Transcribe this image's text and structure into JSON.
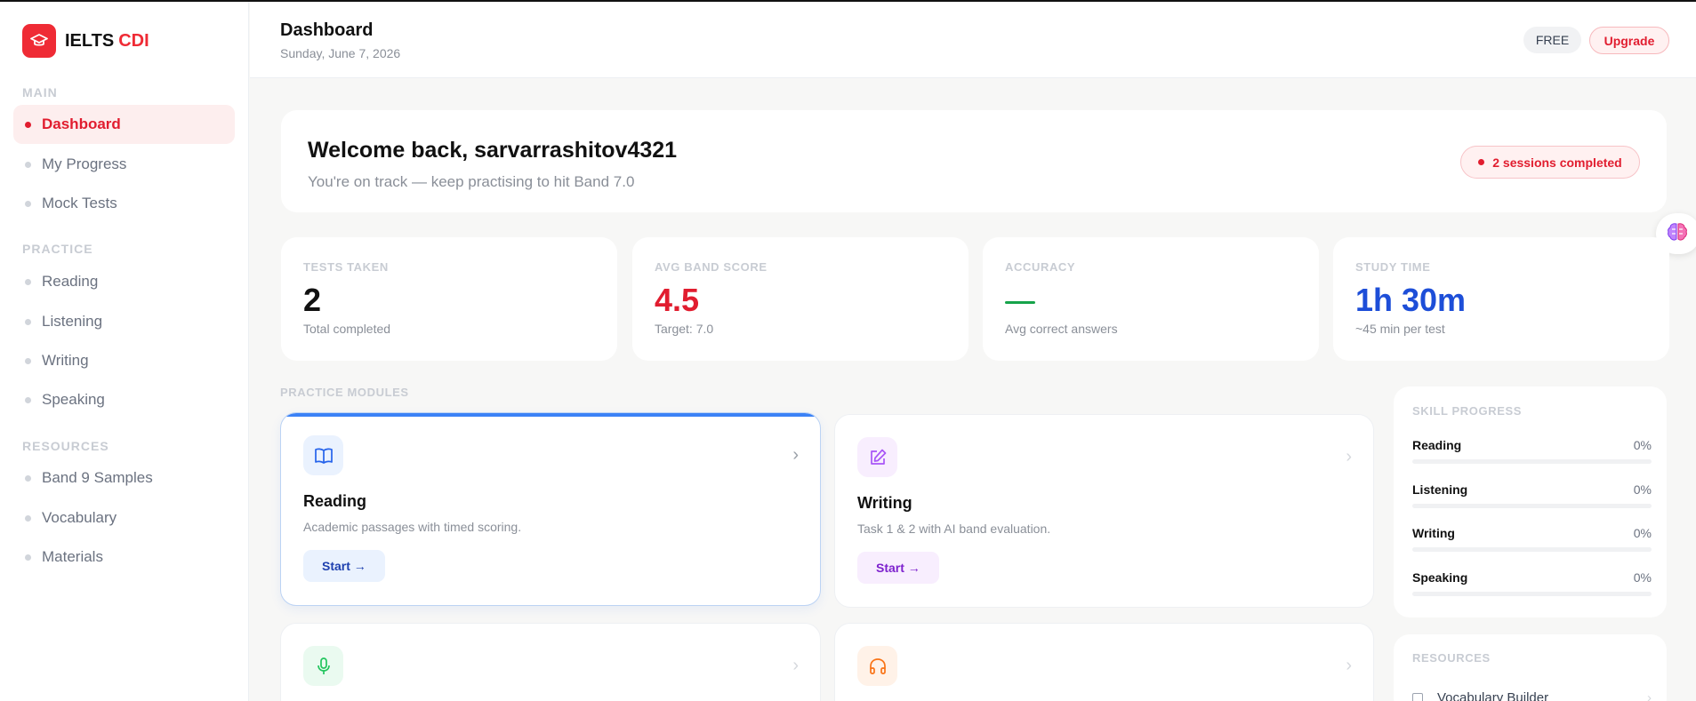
{
  "brand": {
    "name": "IELTS",
    "accent": "CDI",
    "icon": "graduation-cap-icon",
    "color": "#ef2b35"
  },
  "sidebar": {
    "sections": [
      {
        "title": "MAIN",
        "items": [
          {
            "label": "Dashboard",
            "active": true
          },
          {
            "label": "My Progress"
          },
          {
            "label": "Mock Tests"
          }
        ]
      },
      {
        "title": "PRACTICE",
        "items": [
          {
            "label": "Reading"
          },
          {
            "label": "Listening"
          },
          {
            "label": "Writing"
          },
          {
            "label": "Speaking"
          }
        ]
      },
      {
        "title": "RESOURCES",
        "items": [
          {
            "label": "Band 9 Samples"
          },
          {
            "label": "Vocabulary"
          },
          {
            "label": "Materials"
          }
        ]
      }
    ]
  },
  "header": {
    "title": "Dashboard",
    "date": "Sunday, June 7, 2026",
    "plan_badge": "FREE",
    "upgrade_label": "Upgrade"
  },
  "welcome": {
    "title": "Welcome back, sarvarrashitov4321",
    "subtitle": "You're on track — keep practising to hit Band 7.0",
    "sessions_label": "2 sessions completed"
  },
  "stats": [
    {
      "label": "TESTS TAKEN",
      "value": "2",
      "sub": "Total completed",
      "color": "#111111"
    },
    {
      "label": "AVG BAND SCORE",
      "value": "4.5",
      "sub": "Target: 7.0",
      "color": "#e11d2f"
    },
    {
      "label": "ACCURACY",
      "value": "",
      "sub": "Avg correct answers",
      "color": "#16a34a"
    },
    {
      "label": "STUDY TIME",
      "value": "1h 30m",
      "sub": "~45 min per test",
      "color": "#1d4ed8"
    }
  ],
  "modules_section_label": "PRACTICE MODULES",
  "modules": [
    {
      "title": "Reading",
      "desc": "Academic passages with timed scoring.",
      "button": "Start →",
      "icon": "book-open-icon",
      "accent": "#2563eb"
    },
    {
      "title": "Writing",
      "desc": "Task 1 & 2 with AI band evaluation.",
      "button": "Start →",
      "icon": "edit-icon",
      "accent": "#9333ea"
    },
    {
      "title": "Speaking",
      "icon": "microphone-icon",
      "accent": "#16a34a"
    },
    {
      "title": "Listening",
      "icon": "headphones-icon",
      "accent": "#ea580c"
    }
  ],
  "skill_progress": {
    "title": "SKILL PROGRESS",
    "skills": [
      {
        "name": "Reading",
        "label": "0%",
        "value": 0
      },
      {
        "name": "Listening",
        "label": "0%",
        "value": 0
      },
      {
        "name": "Writing",
        "label": "0%",
        "value": 0
      },
      {
        "name": "Speaking",
        "label": "0%",
        "value": 0
      }
    ]
  },
  "resources": {
    "title": "RESOURCES",
    "items": [
      {
        "label": "Vocabulary Builder"
      }
    ]
  }
}
